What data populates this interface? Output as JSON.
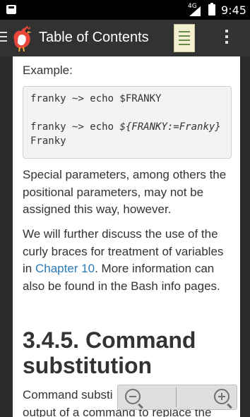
{
  "status_bar": {
    "network": "4G",
    "time": "9:45"
  },
  "app_bar": {
    "title": "Table of Contents"
  },
  "content": {
    "example_label": "Example:",
    "code": {
      "line1": "franky ~> echo $FRANKY",
      "line2_prompt": "franky ~> echo ",
      "line2_var": "${FRANKY:=Franky}",
      "line3": "Franky"
    },
    "para1": "Special parameters, among others the positional parameters, may not be assigned this way, however.",
    "para2_a": "We will further discuss the use of the curly braces for treatment of variables in ",
    "para2_link": "Chapter 10",
    "para2_b": ". More information can also be found in the Bash info pages.",
    "heading": "3.4.5. Command substitution",
    "para3_line1": "Command substi",
    "para3_line2": "output of a command to replace the"
  },
  "icons": {
    "menu": "hamburger-icon",
    "logo": "rooster-logo-icon",
    "toc": "toc-document-icon",
    "overflow": "more-vertical-icon",
    "zoom_out": "zoom-out-icon",
    "zoom_in": "zoom-in-icon"
  }
}
